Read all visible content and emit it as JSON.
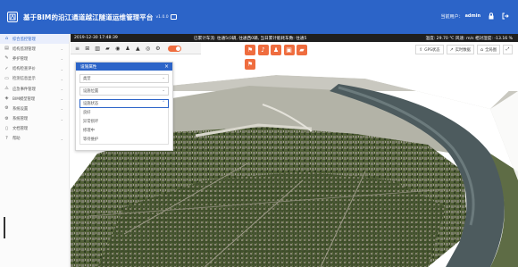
{
  "header": {
    "title": "基于BIM的沿江通道越江隧道运维管理平台",
    "version": "v1.0.0",
    "user_label": "当前用户：",
    "user_name": "admin"
  },
  "sidebar": {
    "items": [
      {
        "label": "综合监控管理",
        "icon": "home-icon",
        "active": true,
        "chevron": false
      },
      {
        "label": "结构监测管理",
        "icon": "chart-icon",
        "active": false,
        "chevron": true
      },
      {
        "label": "养护管理",
        "icon": "wrench-icon",
        "active": false,
        "chevron": true
      },
      {
        "label": "结构检查评价",
        "icon": "check-icon",
        "active": false,
        "chevron": true
      },
      {
        "label": "检测信息显示",
        "icon": "monitor-icon",
        "active": false,
        "chevron": true
      },
      {
        "label": "应急事件管理",
        "icon": "alert-icon",
        "active": false,
        "chevron": true
      },
      {
        "label": "BIM模型管理",
        "icon": "cube-icon",
        "active": false,
        "chevron": true
      },
      {
        "label": "系统设置",
        "icon": "gear-icon",
        "active": false,
        "chevron": true
      },
      {
        "label": "系统管理",
        "icon": "settings-icon",
        "active": false,
        "chevron": true
      },
      {
        "label": "文档管理",
        "icon": "document-icon",
        "active": false,
        "chevron": false
      },
      {
        "label": "帮助",
        "icon": "help-icon",
        "active": false,
        "chevron": true
      }
    ]
  },
  "info_bar": {
    "datetime": "2019-12-30 17:48:39",
    "stats": "已累计车流: 往通5(0辆, 往通西0辆, 当日累计能耗车数: 往通5",
    "weather": "温度: 29.70 ℃  风速: m/s  相对湿度: -13.16 %"
  },
  "toolbar": {
    "buttons": [
      "layers-icon",
      "road-icon",
      "building-icon",
      "truck-icon",
      "camera-icon",
      "person-icon",
      "warning-icon",
      "target-icon",
      "settings-icon"
    ]
  },
  "orange_buttons": [
    "sign-icon",
    "signal-icon",
    "person-icon",
    "car-icon",
    "truck-icon"
  ],
  "orange_single": "sign-icon",
  "right_buttons": {
    "gps": "GPS状态",
    "realtime": "实时数据",
    "overview": "全局图"
  },
  "panel": {
    "title": "设施属性",
    "select1": "类型",
    "select2": "设施位置",
    "select3": "设施状态",
    "options": [
      "良好",
      "异常损坏",
      "修理中",
      "等待维护"
    ]
  },
  "colors": {
    "brand": "#2c64c8",
    "accent": "#ef6d3f"
  }
}
